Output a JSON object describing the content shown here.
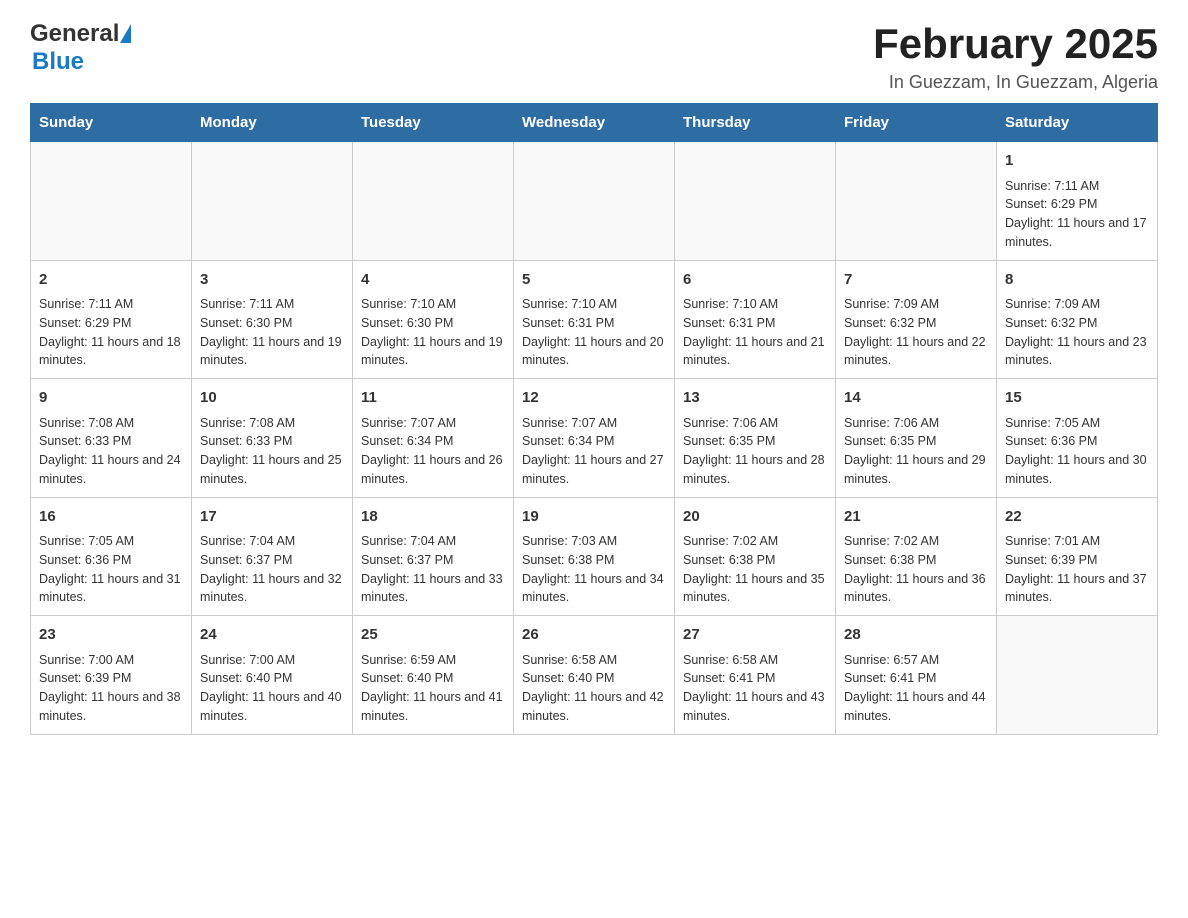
{
  "header": {
    "logo": {
      "general_text": "General",
      "blue_text": "Blue"
    },
    "title": "February 2025",
    "subtitle": "In Guezzam, In Guezzam, Algeria"
  },
  "days_of_week": [
    "Sunday",
    "Monday",
    "Tuesday",
    "Wednesday",
    "Thursday",
    "Friday",
    "Saturday"
  ],
  "weeks": [
    {
      "days": [
        {
          "number": "",
          "sunrise": "",
          "sunset": "",
          "daylight": "",
          "empty": true
        },
        {
          "number": "",
          "sunrise": "",
          "sunset": "",
          "daylight": "",
          "empty": true
        },
        {
          "number": "",
          "sunrise": "",
          "sunset": "",
          "daylight": "",
          "empty": true
        },
        {
          "number": "",
          "sunrise": "",
          "sunset": "",
          "daylight": "",
          "empty": true
        },
        {
          "number": "",
          "sunrise": "",
          "sunset": "",
          "daylight": "",
          "empty": true
        },
        {
          "number": "",
          "sunrise": "",
          "sunset": "",
          "daylight": "",
          "empty": true
        },
        {
          "number": "1",
          "sunrise": "Sunrise: 7:11 AM",
          "sunset": "Sunset: 6:29 PM",
          "daylight": "Daylight: 11 hours and 17 minutes.",
          "empty": false
        }
      ]
    },
    {
      "days": [
        {
          "number": "2",
          "sunrise": "Sunrise: 7:11 AM",
          "sunset": "Sunset: 6:29 PM",
          "daylight": "Daylight: 11 hours and 18 minutes.",
          "empty": false
        },
        {
          "number": "3",
          "sunrise": "Sunrise: 7:11 AM",
          "sunset": "Sunset: 6:30 PM",
          "daylight": "Daylight: 11 hours and 19 minutes.",
          "empty": false
        },
        {
          "number": "4",
          "sunrise": "Sunrise: 7:10 AM",
          "sunset": "Sunset: 6:30 PM",
          "daylight": "Daylight: 11 hours and 19 minutes.",
          "empty": false
        },
        {
          "number": "5",
          "sunrise": "Sunrise: 7:10 AM",
          "sunset": "Sunset: 6:31 PM",
          "daylight": "Daylight: 11 hours and 20 minutes.",
          "empty": false
        },
        {
          "number": "6",
          "sunrise": "Sunrise: 7:10 AM",
          "sunset": "Sunset: 6:31 PM",
          "daylight": "Daylight: 11 hours and 21 minutes.",
          "empty": false
        },
        {
          "number": "7",
          "sunrise": "Sunrise: 7:09 AM",
          "sunset": "Sunset: 6:32 PM",
          "daylight": "Daylight: 11 hours and 22 minutes.",
          "empty": false
        },
        {
          "number": "8",
          "sunrise": "Sunrise: 7:09 AM",
          "sunset": "Sunset: 6:32 PM",
          "daylight": "Daylight: 11 hours and 23 minutes.",
          "empty": false
        }
      ]
    },
    {
      "days": [
        {
          "number": "9",
          "sunrise": "Sunrise: 7:08 AM",
          "sunset": "Sunset: 6:33 PM",
          "daylight": "Daylight: 11 hours and 24 minutes.",
          "empty": false
        },
        {
          "number": "10",
          "sunrise": "Sunrise: 7:08 AM",
          "sunset": "Sunset: 6:33 PM",
          "daylight": "Daylight: 11 hours and 25 minutes.",
          "empty": false
        },
        {
          "number": "11",
          "sunrise": "Sunrise: 7:07 AM",
          "sunset": "Sunset: 6:34 PM",
          "daylight": "Daylight: 11 hours and 26 minutes.",
          "empty": false
        },
        {
          "number": "12",
          "sunrise": "Sunrise: 7:07 AM",
          "sunset": "Sunset: 6:34 PM",
          "daylight": "Daylight: 11 hours and 27 minutes.",
          "empty": false
        },
        {
          "number": "13",
          "sunrise": "Sunrise: 7:06 AM",
          "sunset": "Sunset: 6:35 PM",
          "daylight": "Daylight: 11 hours and 28 minutes.",
          "empty": false
        },
        {
          "number": "14",
          "sunrise": "Sunrise: 7:06 AM",
          "sunset": "Sunset: 6:35 PM",
          "daylight": "Daylight: 11 hours and 29 minutes.",
          "empty": false
        },
        {
          "number": "15",
          "sunrise": "Sunrise: 7:05 AM",
          "sunset": "Sunset: 6:36 PM",
          "daylight": "Daylight: 11 hours and 30 minutes.",
          "empty": false
        }
      ]
    },
    {
      "days": [
        {
          "number": "16",
          "sunrise": "Sunrise: 7:05 AM",
          "sunset": "Sunset: 6:36 PM",
          "daylight": "Daylight: 11 hours and 31 minutes.",
          "empty": false
        },
        {
          "number": "17",
          "sunrise": "Sunrise: 7:04 AM",
          "sunset": "Sunset: 6:37 PM",
          "daylight": "Daylight: 11 hours and 32 minutes.",
          "empty": false
        },
        {
          "number": "18",
          "sunrise": "Sunrise: 7:04 AM",
          "sunset": "Sunset: 6:37 PM",
          "daylight": "Daylight: 11 hours and 33 minutes.",
          "empty": false
        },
        {
          "number": "19",
          "sunrise": "Sunrise: 7:03 AM",
          "sunset": "Sunset: 6:38 PM",
          "daylight": "Daylight: 11 hours and 34 minutes.",
          "empty": false
        },
        {
          "number": "20",
          "sunrise": "Sunrise: 7:02 AM",
          "sunset": "Sunset: 6:38 PM",
          "daylight": "Daylight: 11 hours and 35 minutes.",
          "empty": false
        },
        {
          "number": "21",
          "sunrise": "Sunrise: 7:02 AM",
          "sunset": "Sunset: 6:38 PM",
          "daylight": "Daylight: 11 hours and 36 minutes.",
          "empty": false
        },
        {
          "number": "22",
          "sunrise": "Sunrise: 7:01 AM",
          "sunset": "Sunset: 6:39 PM",
          "daylight": "Daylight: 11 hours and 37 minutes.",
          "empty": false
        }
      ]
    },
    {
      "days": [
        {
          "number": "23",
          "sunrise": "Sunrise: 7:00 AM",
          "sunset": "Sunset: 6:39 PM",
          "daylight": "Daylight: 11 hours and 38 minutes.",
          "empty": false
        },
        {
          "number": "24",
          "sunrise": "Sunrise: 7:00 AM",
          "sunset": "Sunset: 6:40 PM",
          "daylight": "Daylight: 11 hours and 40 minutes.",
          "empty": false
        },
        {
          "number": "25",
          "sunrise": "Sunrise: 6:59 AM",
          "sunset": "Sunset: 6:40 PM",
          "daylight": "Daylight: 11 hours and 41 minutes.",
          "empty": false
        },
        {
          "number": "26",
          "sunrise": "Sunrise: 6:58 AM",
          "sunset": "Sunset: 6:40 PM",
          "daylight": "Daylight: 11 hours and 42 minutes.",
          "empty": false
        },
        {
          "number": "27",
          "sunrise": "Sunrise: 6:58 AM",
          "sunset": "Sunset: 6:41 PM",
          "daylight": "Daylight: 11 hours and 43 minutes.",
          "empty": false
        },
        {
          "number": "28",
          "sunrise": "Sunrise: 6:57 AM",
          "sunset": "Sunset: 6:41 PM",
          "daylight": "Daylight: 11 hours and 44 minutes.",
          "empty": false
        },
        {
          "number": "",
          "sunrise": "",
          "sunset": "",
          "daylight": "",
          "empty": true
        }
      ]
    }
  ]
}
